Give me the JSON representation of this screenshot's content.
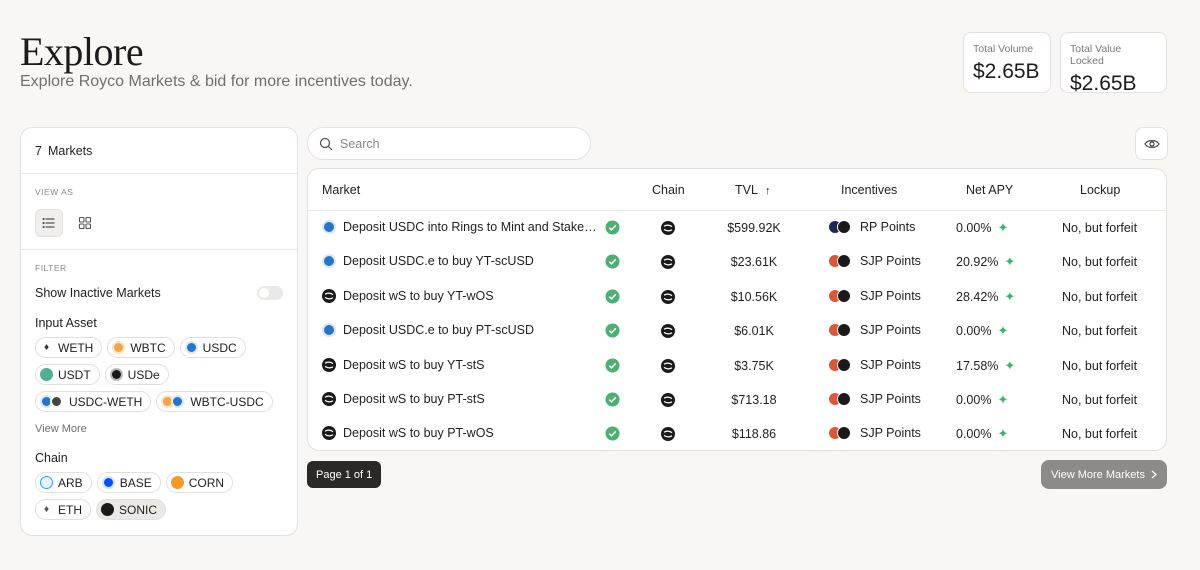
{
  "header": {
    "title": "Explore",
    "subtitle": "Explore Royco Markets & bid for more incentives today."
  },
  "stats": [
    {
      "label": "Total Volume",
      "value": "$2.65B"
    },
    {
      "label": "Total Value Locked",
      "value": "$2.65B"
    }
  ],
  "sidebar": {
    "market_count": "7",
    "market_count_label": "Markets",
    "view_as_label": "VIEW AS",
    "filter_label": "FILTER",
    "show_inactive_label": "Show Inactive Markets",
    "input_asset_label": "Input Asset",
    "input_assets": [
      "WETH",
      "WBTC",
      "USDC",
      "USDT",
      "USDe",
      "USDC-WETH",
      "WBTC-USDC"
    ],
    "view_more_label": "View More",
    "chain_label": "Chain",
    "chains": [
      "ARB",
      "BASE",
      "CORN",
      "ETH",
      "SONIC"
    ]
  },
  "search": {
    "placeholder": "Search"
  },
  "table": {
    "headers": {
      "market": "Market",
      "chain": "Chain",
      "tvl": "TVL",
      "sort_arrow": "↑",
      "incentives": "Incentives",
      "net_apy": "Net APY",
      "lockup": "Lockup"
    },
    "rows": [
      {
        "market": "Deposit USDC into Rings to Mint and Stake scUSD",
        "icon": "usdc",
        "tvl": "$599.92K",
        "incentive": "RP Points",
        "apy": "0.00%",
        "lockup": "No, but forfeit"
      },
      {
        "market": "Deposit USDC.e to buy YT-scUSD",
        "icon": "usdc",
        "tvl": "$23.61K",
        "incentive": "SJP Points",
        "apy": "20.92%",
        "lockup": "No, but forfeit"
      },
      {
        "market": "Deposit wS to buy YT-wOS",
        "icon": "sonic",
        "tvl": "$10.56K",
        "incentive": "SJP Points",
        "apy": "28.42%",
        "lockup": "No, but forfeit"
      },
      {
        "market": "Deposit USDC.e to buy PT-scUSD",
        "icon": "usdc",
        "tvl": "$6.01K",
        "incentive": "SJP Points",
        "apy": "0.00%",
        "lockup": "No, but forfeit"
      },
      {
        "market": "Deposit wS to buy YT-stS",
        "icon": "sonic",
        "tvl": "$3.75K",
        "incentive": "SJP Points",
        "apy": "17.58%",
        "lockup": "No, but forfeit"
      },
      {
        "market": "Deposit wS to buy PT-stS",
        "icon": "sonic",
        "tvl": "$713.18",
        "incentive": "SJP Points",
        "apy": "0.00%",
        "lockup": "No, but forfeit"
      },
      {
        "market": "Deposit wS to buy PT-wOS",
        "icon": "sonic",
        "tvl": "$118.86",
        "incentive": "SJP Points",
        "apy": "0.00%",
        "lockup": "No, but forfeit"
      }
    ]
  },
  "pagination": {
    "label": "Page 1 of 1"
  },
  "view_more_markets": "View More Markets",
  "colors": {
    "accent": "#2a2926",
    "verified": "#4fae73",
    "sparkle": "#3cb56a",
    "usdc": "#2775ca"
  }
}
